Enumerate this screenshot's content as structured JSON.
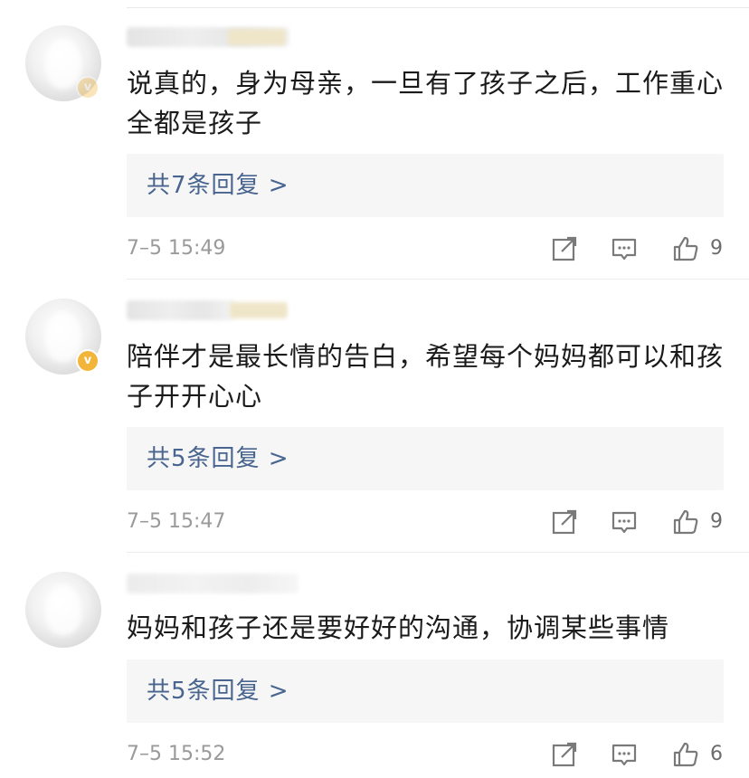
{
  "comments": [
    {
      "content": "说真的，身为母亲，一旦有了孩子之后，工作重心全都是孩子",
      "reply_label": "共7条回复 >",
      "timestamp": "7–5 15:49",
      "like_count": "9",
      "verified_badge": "v"
    },
    {
      "content": "陪伴才是最长情的告白，希望每个妈妈都可以和孩子开开心心",
      "reply_label": "共5条回复 >",
      "timestamp": "7–5 15:47",
      "like_count": "9",
      "verified_badge": "v"
    },
    {
      "content": "妈妈和孩子还是要好好的沟通，协调某些事情",
      "reply_label": "共5条回复 >",
      "timestamp": "7–5 15:52",
      "like_count": "6"
    }
  ],
  "icons": {
    "share": "share-icon",
    "comment": "comment-icon",
    "like": "thumbs-up-icon"
  },
  "colors": {
    "reply_link": "#48648f",
    "badge": "#f2b53a",
    "meta_text": "#9a9a9a"
  }
}
